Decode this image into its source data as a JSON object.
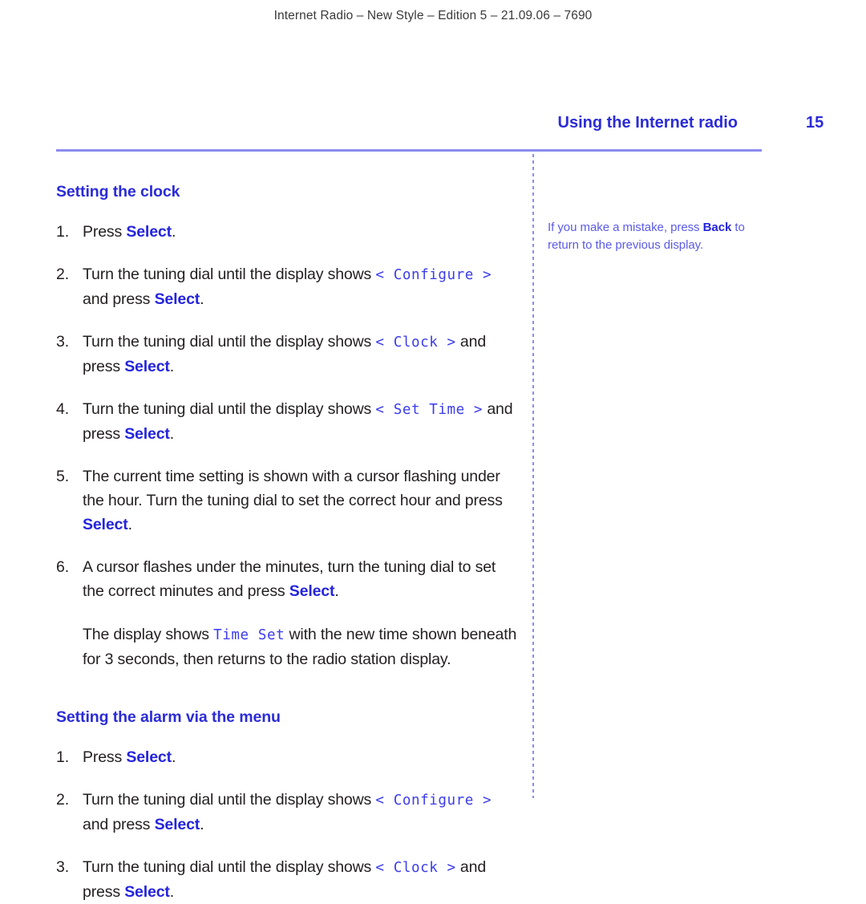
{
  "running_head": "Internet Radio – New Style – Edition 5 – 21.09.06 – 7690",
  "header": {
    "chapter_title": "Using the Internet radio",
    "page_number": "15"
  },
  "colors": {
    "accent_blue": "#2b2bd8",
    "bold_blue": "#2424dd",
    "lcd_blue": "#3b3bee",
    "rule_blue": "#8b8bf0",
    "note_blue": "#5b5be6",
    "body_text": "#231f20"
  },
  "sections": [
    {
      "heading": "Setting the clock",
      "steps": [
        {
          "number": "1.",
          "parts": [
            {
              "type": "text",
              "value": "Press "
            },
            {
              "type": "bold",
              "value": "Select"
            },
            {
              "type": "text",
              "value": "."
            }
          ]
        },
        {
          "number": "2.",
          "parts": [
            {
              "type": "text",
              "value": "Turn the tuning dial until the display shows "
            },
            {
              "type": "lcd",
              "value": "< Configure >"
            },
            {
              "type": "text",
              "value": " and press "
            },
            {
              "type": "bold",
              "value": "Select"
            },
            {
              "type": "text",
              "value": "."
            }
          ]
        },
        {
          "number": "3.",
          "parts": [
            {
              "type": "text",
              "value": "Turn the tuning dial until the display shows "
            },
            {
              "type": "lcd",
              "value": "< Clock >"
            },
            {
              "type": "text",
              "value": " and press "
            },
            {
              "type": "bold",
              "value": "Select"
            },
            {
              "type": "text",
              "value": "."
            }
          ]
        },
        {
          "number": "4.",
          "parts": [
            {
              "type": "text",
              "value": "Turn the tuning dial until the display shows "
            },
            {
              "type": "lcd",
              "value": "< Set Time >"
            },
            {
              "type": "text",
              "value": " and press "
            },
            {
              "type": "bold",
              "value": "Select"
            },
            {
              "type": "text",
              "value": "."
            }
          ]
        },
        {
          "number": "5.",
          "parts": [
            {
              "type": "text",
              "value": "The current time setting is shown with a cursor flashing under the hour. Turn the tuning dial to set the correct hour and press "
            },
            {
              "type": "bold",
              "value": "Select"
            },
            {
              "type": "text",
              "value": "."
            }
          ]
        },
        {
          "number": "6.",
          "parts": [
            {
              "type": "text",
              "value": "A cursor flashes under the minutes, turn the tuning dial to set the correct minutes and press "
            },
            {
              "type": "bold",
              "value": "Select"
            },
            {
              "type": "text",
              "value": "."
            }
          ]
        }
      ],
      "trailing_paragraph": [
        {
          "type": "text",
          "value": "The display shows "
        },
        {
          "type": "lcd",
          "value": "Time Set"
        },
        {
          "type": "text",
          "value": " with the new time shown beneath for 3 seconds, then returns to the radio station display."
        }
      ]
    },
    {
      "heading": "Setting the alarm via the menu",
      "steps": [
        {
          "number": "1.",
          "parts": [
            {
              "type": "text",
              "value": "Press "
            },
            {
              "type": "bold",
              "value": "Select"
            },
            {
              "type": "text",
              "value": "."
            }
          ]
        },
        {
          "number": "2.",
          "parts": [
            {
              "type": "text",
              "value": "Turn the tuning dial until the display shows "
            },
            {
              "type": "lcd",
              "value": "< Configure >"
            },
            {
              "type": "text",
              "value": " and press "
            },
            {
              "type": "bold",
              "value": "Select"
            },
            {
              "type": "text",
              "value": "."
            }
          ]
        },
        {
          "number": "3.",
          "parts": [
            {
              "type": "text",
              "value": "Turn the tuning dial until the display shows "
            },
            {
              "type": "lcd",
              "value": "< Clock >"
            },
            {
              "type": "text",
              "value": " and press "
            },
            {
              "type": "bold",
              "value": "Select"
            },
            {
              "type": "text",
              "value": "."
            }
          ]
        }
      ],
      "trailing_paragraph": null
    }
  ],
  "side_note": [
    {
      "type": "text",
      "value": "If you make a mistake, press "
    },
    {
      "type": "bold",
      "value": "Back"
    },
    {
      "type": "text",
      "value": " to return to the previous display."
    }
  ]
}
